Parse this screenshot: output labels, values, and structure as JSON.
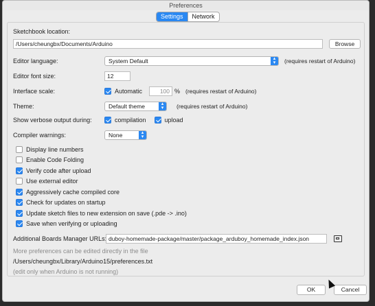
{
  "window": {
    "title": "Preferences"
  },
  "tabs": [
    {
      "label": "Settings"
    },
    {
      "label": "Network"
    }
  ],
  "sketchbook": {
    "label": "Sketchbook location:",
    "path": "/Users/cheungbx/Documents/Arduino",
    "browse_label": "Browse"
  },
  "editor_language": {
    "label": "Editor language:",
    "value": "System Default",
    "note": "(requires restart of Arduino)"
  },
  "editor_font_size": {
    "label": "Editor font size:",
    "value": "12"
  },
  "interface_scale": {
    "label": "Interface scale:",
    "automatic_label": "Automatic",
    "automatic_checked": true,
    "value": "100",
    "unit": "%",
    "note": "(requires restart of Arduino)"
  },
  "theme": {
    "label": "Theme:",
    "value": "Default theme",
    "note": "(requires restart of Arduino)"
  },
  "verbose": {
    "label": "Show verbose output during:",
    "compilation_label": "compilation",
    "compilation_checked": true,
    "upload_label": "upload",
    "upload_checked": true
  },
  "compiler_warnings": {
    "label": "Compiler warnings:",
    "value": "None"
  },
  "options": [
    {
      "label": "Display line numbers",
      "checked": false
    },
    {
      "label": "Enable Code Folding",
      "checked": false
    },
    {
      "label": "Verify code after upload",
      "checked": true
    },
    {
      "label": "Use external editor",
      "checked": false
    },
    {
      "label": "Aggressively cache compiled core",
      "checked": true
    },
    {
      "label": "Check for updates on startup",
      "checked": true
    },
    {
      "label": "Update sketch files to new extension on save (.pde -> .ino)",
      "checked": true
    },
    {
      "label": "Save when verifying or uploading",
      "checked": true
    }
  ],
  "boards_manager": {
    "label": "Additional Boards Manager URLs:",
    "value": "duboy-homemade-package/master/package_arduboy_homemade_index.json"
  },
  "footer_info": {
    "more_text": "More preferences can be edited directly in the file",
    "prefs_path": "/Users/cheungbx/Library/Arduino15/preferences.txt",
    "edit_note": "(edit only when Arduino is not running)"
  },
  "buttons": {
    "ok": "OK",
    "cancel": "Cancel"
  },
  "colors": {
    "accent": "#2a88f2",
    "window_bg": "#ececec"
  },
  "icons": {
    "open_window": "window-open-icon",
    "select_stepper": "updown-chevron-icon"
  }
}
